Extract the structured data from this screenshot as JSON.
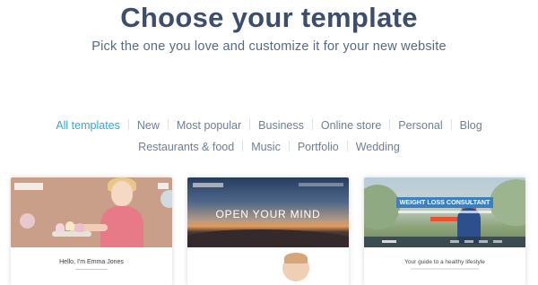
{
  "header": {
    "title": "Choose your template",
    "subtitle": "Pick the one you love and customize it for your new website"
  },
  "filters": {
    "row1": [
      {
        "label": "All templates",
        "active": true
      },
      {
        "label": "New"
      },
      {
        "label": "Most popular"
      },
      {
        "label": "Business"
      },
      {
        "label": "Online store"
      },
      {
        "label": "Personal"
      },
      {
        "label": "Blog"
      }
    ],
    "row2": [
      {
        "label": "Restaurants & food"
      },
      {
        "label": "Music"
      },
      {
        "label": "Portfolio"
      },
      {
        "label": "Wedding"
      }
    ]
  },
  "cards": [
    {
      "caption": "Hello, I'm Emma Jones"
    },
    {
      "headline": "OPEN YOUR MIND"
    },
    {
      "banner": "WEIGHT LOSS CONSULTANT",
      "caption": "Your guide to a healthy lifestyle"
    }
  ],
  "colors": {
    "title": "#3c4e6b",
    "active_filter": "#2eaadb",
    "filter": "#6d7f98"
  }
}
